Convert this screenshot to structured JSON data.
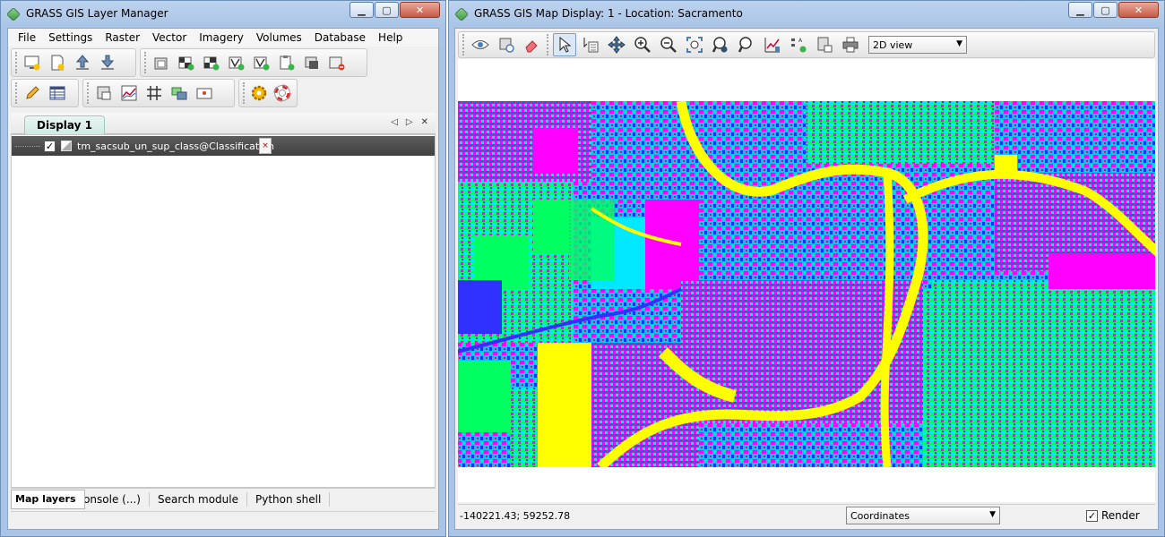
{
  "layer_manager": {
    "title": "GRASS GIS Layer Manager",
    "menu": [
      "File",
      "Settings",
      "Raster",
      "Vector",
      "Imagery",
      "Volumes",
      "Database",
      "Help"
    ],
    "display_tab": "Display 1",
    "layer": {
      "name": "tm_sacsub_un_sup_class@Classification",
      "checked": "✓"
    },
    "bottom_tabs": [
      "Map layers",
      "Command console (...)",
      "Search module",
      "Python shell"
    ]
  },
  "map_display": {
    "title": "GRASS GIS Map Display: 1  - Location: Sacramento",
    "view_mode": "2D view",
    "coordinates": "-140221.43; 59252.78",
    "status_mode": "Coordinates",
    "render_label": "Render",
    "render_checked": "✓"
  },
  "colors": {
    "accent": "#a9c4e6",
    "magenta": "#ff00ff",
    "yellow": "#ffff00",
    "cyan": "#00e0ff",
    "blue": "#2828ff",
    "green": "#00ff60",
    "red": "#ff0050"
  }
}
